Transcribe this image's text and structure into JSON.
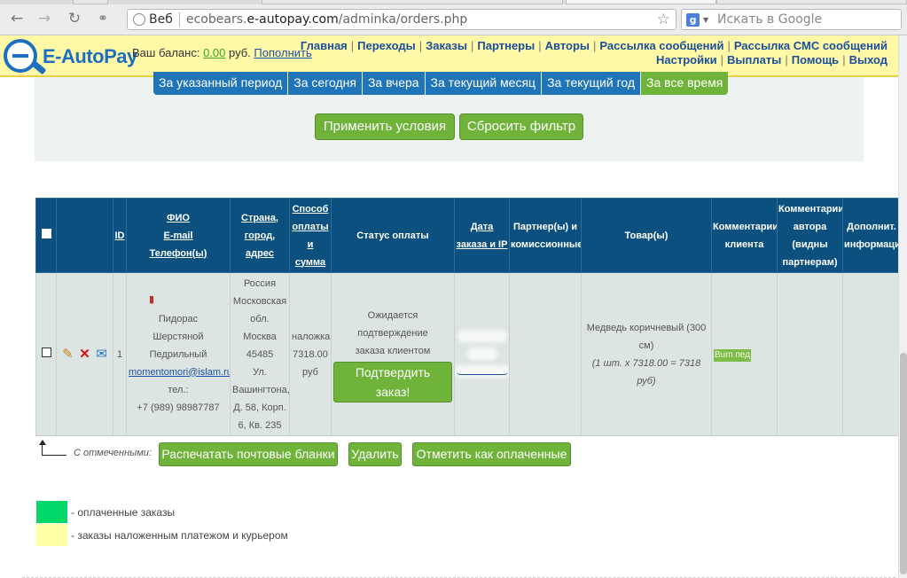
{
  "browser": {
    "web_label": "Веб",
    "url_prefix": "ecobears.",
    "url_host": "e-autopay.com",
    "url_path": "/adminka/orders.php",
    "search_placeholder": "Искать в Google",
    "search_engine_icon": "google-icon"
  },
  "header": {
    "logo_text": "E-AutoPay",
    "balance_label": "Ваш баланс:",
    "balance_value": "0.00",
    "balance_currency": "руб.",
    "topup_link": "Пополнить",
    "nav_row1": [
      "Главная",
      "Переходы",
      "Заказы",
      "Партнеры",
      "Авторы",
      "Рассылка сообщений",
      "Рассылка СМС сообщений"
    ],
    "nav_row2": [
      "Настройки",
      "Выплаты",
      "Помощь",
      "Выход"
    ]
  },
  "filter": {
    "periods": [
      "За указанный период",
      "За сегодня",
      "За вчера",
      "За текущий месяц",
      "За текущий год",
      "За все время"
    ],
    "active_period": "За все время",
    "apply_button": "Применить условия",
    "reset_button": "Сбросить фильтр"
  },
  "table": {
    "headers": {
      "id": "ID",
      "fio": [
        "ФИО",
        "E-mail",
        "Телефон(ы)"
      ],
      "country": [
        "Страна,",
        "город,",
        "адрес"
      ],
      "payment": [
        "Способ",
        "оплаты",
        "и",
        "сумма"
      ],
      "status": "Статус оплаты",
      "date": [
        "Дата",
        "заказа и IP"
      ],
      "partners": [
        "Партнер(ы) и",
        "комиссионные"
      ],
      "goods": "Товар(ы)",
      "client_comment": [
        "Комментарии",
        "клиента"
      ],
      "author_comment": [
        "Комментарии",
        "автора",
        "(видны",
        "партнерам)"
      ],
      "extra": [
        "Дополнит.",
        "информаци"
      ]
    },
    "row": {
      "id": "1",
      "name_lines": [
        "Пидорас",
        "Шерстяной",
        "Педрильный"
      ],
      "email": "momentomori@islam.ru",
      "phone_label": "тел.:",
      "phone": "+7 (989) 98987787",
      "address_lines": [
        "Россия",
        "Московская",
        "обл.",
        "Москва",
        "45485",
        "Ул.",
        "Вашингтона,",
        "Д. 58, Корп.",
        "6, Кв. 235"
      ],
      "payment_lines": [
        "наложка",
        "7318.00",
        "руб"
      ],
      "status_lines": [
        "Ожидается подтверждение",
        "заказа клиентом"
      ],
      "confirm_button": "Подтвердить заказ!",
      "product_lines": [
        "Медведь коричневый (300",
        "см)"
      ],
      "product_calc": "(1 шт. x 7318.00 = 7318 руб)",
      "client_comment": "Bum пед"
    }
  },
  "bulk": {
    "label": "С отмеченными:",
    "print_button": "Распечатать почтовые бланки",
    "delete_button": "Удалить",
    "mark_paid_button": "Отметить как оплаченные"
  },
  "legend": {
    "paid_color": "#00d86a",
    "cod_color": "#ffffa8",
    "paid_text": "- оплаченные заказы",
    "cod_text": "- заказы наложенным платежом и курьером"
  },
  "colors": {
    "header_bg": "#fff9a7",
    "table_header": "#0b507f",
    "green_button": "#6fb33b",
    "blue_tab": "#1f75b8"
  }
}
